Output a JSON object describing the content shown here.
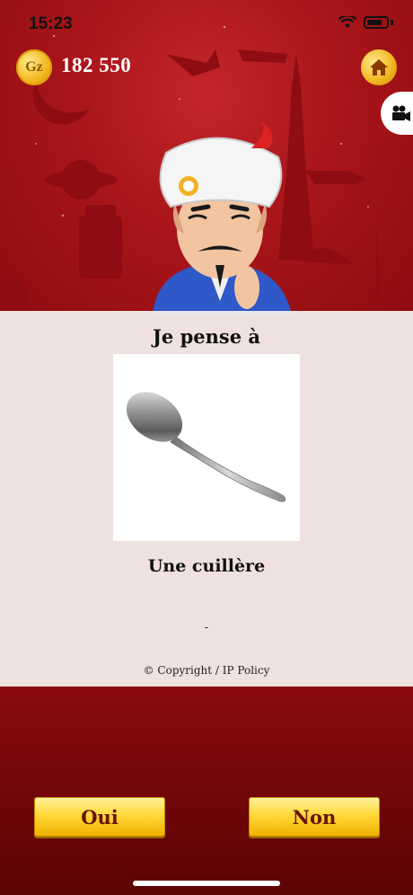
{
  "status": {
    "time": "15:23"
  },
  "header": {
    "coin_symbol": "Gz",
    "coins": "182 550"
  },
  "panel": {
    "title": "Je pense à",
    "guess": "Une cuillère",
    "dash": "-",
    "copyright": "© Copyright / IP Policy"
  },
  "answers": {
    "yes": "Oui",
    "no": "Non"
  },
  "colors": {
    "accent_red": "#a9151a",
    "button_gold": "#ffd83a",
    "button_text": "#6a1406"
  }
}
